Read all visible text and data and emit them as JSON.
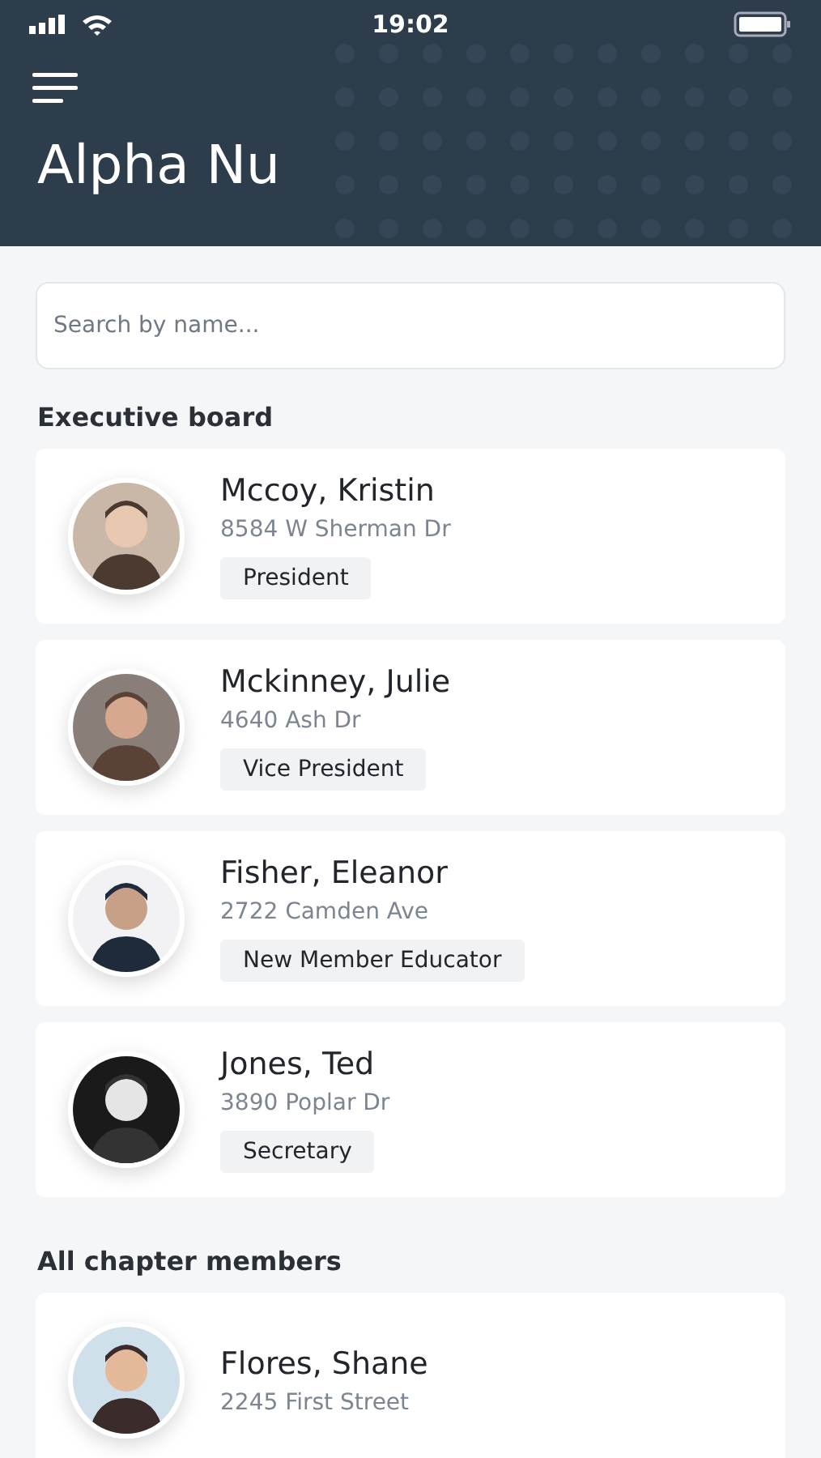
{
  "status_bar": {
    "time": "19:02"
  },
  "header": {
    "title": "Alpha Nu"
  },
  "search": {
    "placeholder": "Search by name..."
  },
  "sections": [
    {
      "title": "Executive board",
      "members": [
        {
          "name": "Mccoy, Kristin",
          "address": "8584 W Sherman Dr",
          "role": "President"
        },
        {
          "name": "Mckinney, Julie",
          "address": "4640 Ash Dr",
          "role": "Vice President"
        },
        {
          "name": "Fisher, Eleanor",
          "address": "2722 Camden Ave",
          "role": "New Member Educator"
        },
        {
          "name": "Jones, Ted",
          "address": "3890 Poplar Dr",
          "role": "Secretary"
        }
      ]
    },
    {
      "title": "All chapter members",
      "members": [
        {
          "name": "Flores, Shane",
          "address": "2245 First Street"
        }
      ]
    }
  ]
}
